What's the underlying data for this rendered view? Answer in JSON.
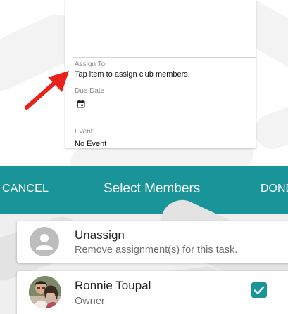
{
  "form": {
    "assign_to": {
      "label": "Assign To:",
      "value": "Tap item to assign club members."
    },
    "due_date": {
      "label": "Due Date",
      "icon": "calendar-icon"
    },
    "event": {
      "label": "Event:",
      "value": "No Event"
    },
    "annotation": {
      "icon": "red-arrow-icon",
      "color": "#e8231c"
    }
  },
  "select_members": {
    "header": {
      "cancel_label": "CANCEL",
      "title": "Select Members",
      "done_label": "DONE"
    },
    "items": [
      {
        "name": "Unassign",
        "subtitle": "Remove assignment(s) for this task.",
        "avatar": "person-placeholder-icon",
        "checked": false
      },
      {
        "name": "Ronnie Toupal",
        "subtitle": "Owner",
        "avatar": "user-photo",
        "checked": true
      }
    ]
  },
  "colors": {
    "accent": "#19959a",
    "arrow": "#e8231c",
    "list_background": "#efefef"
  }
}
